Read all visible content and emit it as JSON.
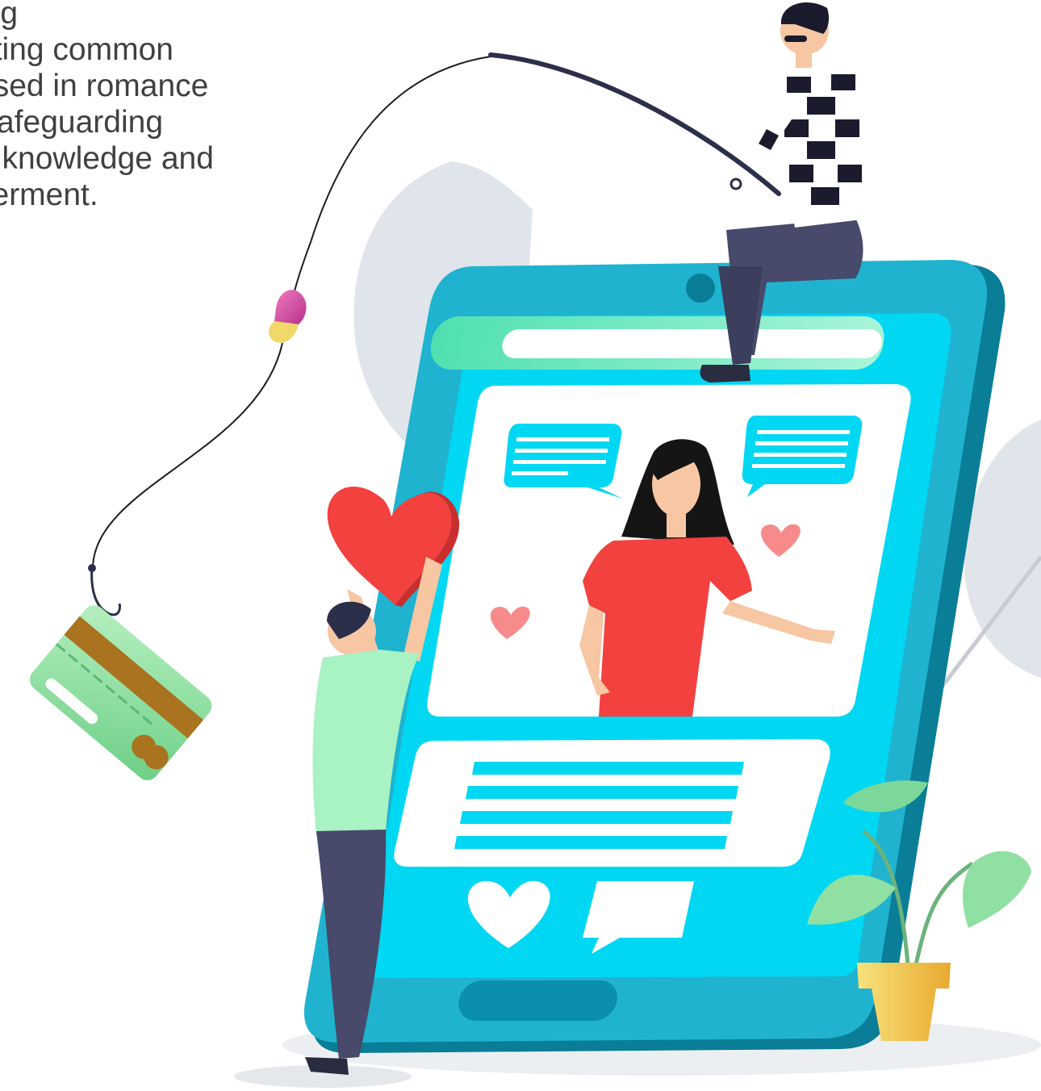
{
  "intro": {
    "lines": [
      "ing",
      "nting common",
      "used in romance",
      "Safeguarding",
      "n knowledge and",
      "verment."
    ]
  },
  "colors": {
    "phone_body": "#1fb3cf",
    "phone_dark": "#0b7f98",
    "screen": "#00d7f3",
    "card_green": "#8fe0a2",
    "heart_red": "#f2413f",
    "dress_red": "#f2413f",
    "leaf_grey": "#dfe5ea",
    "plant_green": "#7cd89a",
    "pot_yellow": "#f2c94c"
  },
  "icons": [
    "fishing-rod-icon",
    "credit-card-icon",
    "heart-icon",
    "chat-bubble-icon",
    "plant-icon"
  ]
}
